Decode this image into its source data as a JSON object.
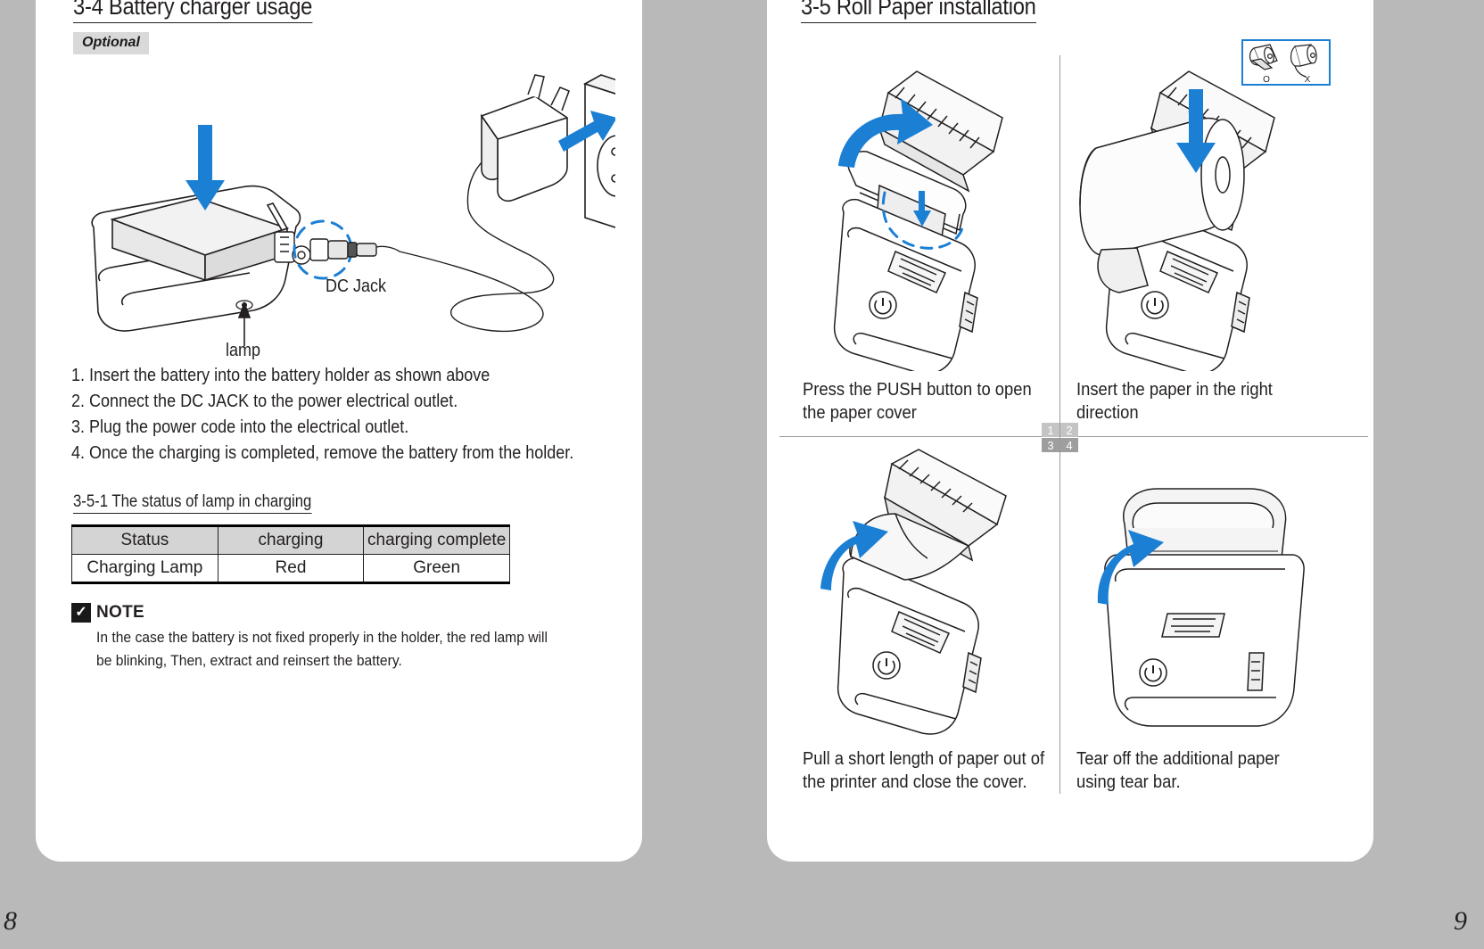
{
  "spread": {
    "page_left_number": "8",
    "page_right_number": "9"
  },
  "left_page": {
    "section_title": "3-4 Battery charger usage",
    "optional_badge": "Optional",
    "figure_labels": {
      "dc_jack": "DC Jack",
      "lamp": "lamp"
    },
    "steps": [
      "1. Insert the battery into the battery holder as shown above",
      "2. Connect the DC JACK to the power electrical outlet.",
      "3. Plug the power code into the electrical outlet.",
      "4. Once the charging is completed, remove the battery from the holder."
    ],
    "sub_section_title": "3-5-1 The status of lamp in charging",
    "status_table": {
      "headers": [
        "Status",
        "charging",
        "charging complete"
      ],
      "rows": [
        {
          "label": "Charging Lamp",
          "charging": "Red",
          "charging_complete": "Green"
        }
      ],
      "colors": {
        "charging": "#ff0000",
        "charging_complete": "#00a64f",
        "header_bg": "#d4d4d4"
      }
    },
    "note": {
      "icon": "check-mark-icon",
      "title": "NOTE",
      "body": "In the case the battery is not fixed properly in the holder, the red lamp will be blinking, Then, extract and reinsert the battery."
    }
  },
  "right_page": {
    "section_title": "3-5 Roll Paper installation",
    "roll_hint": {
      "border_color": "#1b7fd4",
      "correct_label": "O",
      "incorrect_label": "X"
    },
    "quadrant_indicator": [
      "1",
      "2",
      "3",
      "4"
    ],
    "steps": [
      {
        "number": "1",
        "caption": "Press the PUSH button to open the paper cover"
      },
      {
        "number": "2",
        "caption": "Insert the paper in the right direction"
      },
      {
        "number": "3",
        "caption": "Pull a short length of paper out of the printer and close the cover."
      },
      {
        "number": "4",
        "caption": "Tear off the additional paper using tear bar."
      }
    ]
  }
}
